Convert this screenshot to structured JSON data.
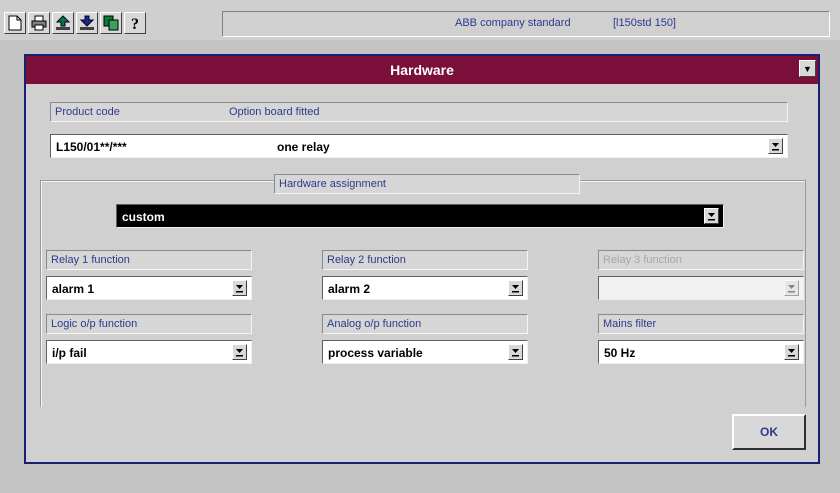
{
  "toolbar": {
    "buttons": [
      {
        "icon": "new-document-icon"
      },
      {
        "icon": "print-icon"
      },
      {
        "icon": "load-icon"
      },
      {
        "icon": "save-icon"
      },
      {
        "icon": "copy-icon"
      },
      {
        "icon": "help-icon"
      }
    ],
    "status_text": "ABB company standard",
    "status_ref": "[l150std 150]"
  },
  "dialog": {
    "title": "Hardware",
    "product_code_label": "Product code",
    "option_board_label": "Option board fitted",
    "product_code_value": "L150/01**/***",
    "option_board_value": "one relay",
    "hardware_assignment_label": "Hardware assignment",
    "hardware_assignment_value": "custom",
    "fields": {
      "relay1": {
        "label": "Relay 1 function",
        "value": "alarm 1"
      },
      "relay2": {
        "label": "Relay 2 function",
        "value": "alarm 2"
      },
      "relay3": {
        "label": "Relay 3 function",
        "value": ""
      },
      "logic": {
        "label": "Logic o/p function",
        "value": "i/p fail"
      },
      "analog": {
        "label": "Analog o/p function",
        "value": "process variable"
      },
      "mains": {
        "label": "Mains filter",
        "value": "50 Hz"
      }
    },
    "ok_label": "OK"
  },
  "colors": {
    "titlebar": "#7a0f3a",
    "dialog_border": "#1b1f72",
    "label_text": "#2c3a8c"
  }
}
